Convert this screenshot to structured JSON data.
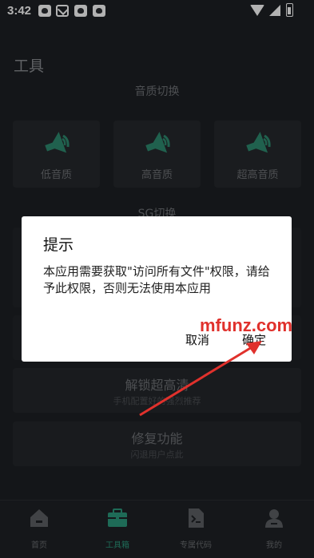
{
  "statusbar": {
    "time": "3:42"
  },
  "page": {
    "title": "工具"
  },
  "sections": {
    "audio_quality": "音质切换",
    "sg": "SG切换"
  },
  "quality_options": [
    {
      "label": "低音质",
      "icon": "speaker-icon"
    },
    {
      "label": "高音质",
      "icon": "speaker-icon"
    },
    {
      "label": "超高音质",
      "icon": "speaker-icon"
    }
  ],
  "features": [
    {
      "title": "解锁超高清",
      "subtitle": "手机配置好的强烈推荐"
    },
    {
      "title": "修复功能",
      "subtitle": "闪退用户点此"
    }
  ],
  "dialog": {
    "title": "提示",
    "message": "本应用需要获取\"访问所有文件\"权限，请给予此权限，否则无法使用本应用",
    "cancel": "取消",
    "confirm": "确定"
  },
  "watermark": "mfunz.com",
  "nav": [
    {
      "label": "首页",
      "icon": "home-icon"
    },
    {
      "label": "工具箱",
      "icon": "toolbox-icon",
      "active": true
    },
    {
      "label": "专属代码",
      "icon": "code-file-icon"
    },
    {
      "label": "我的",
      "icon": "person-icon"
    }
  ],
  "colors": {
    "background": "#1d2024",
    "accent": "#2c9a7d",
    "watermark": "#e0312c"
  }
}
